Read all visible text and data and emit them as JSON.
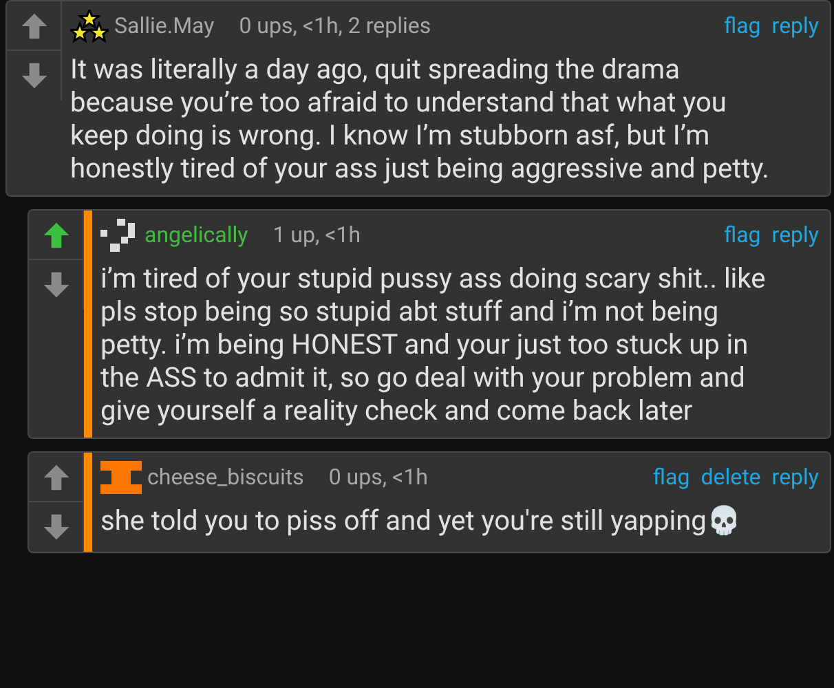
{
  "comments": [
    {
      "username": "Sallie.May",
      "color": "#a8a8a8",
      "avatar": {
        "kind": "stars"
      },
      "meta": "0 ups, <1h, 2 replies",
      "upvoted": false,
      "downvoted": false,
      "nested": false,
      "actions": [
        "flag",
        "reply"
      ],
      "text": "It was literally a day ago, quit spreading the drama because you’re too afraid to understand that what you keep doing is wrong. I know I’m stubborn asf, but I’m honestly tired of your ass just being aggressive and petty."
    },
    {
      "username": "angelically",
      "color": "#44bb44",
      "avatar": {
        "kind": "pixels"
      },
      "meta": "1 up, <1h",
      "upvoted": true,
      "downvoted": false,
      "nested": true,
      "actions": [
        "flag",
        "reply"
      ],
      "text": "i’m tired of your stupid pussy ass doing scary shit.. like pls stop being so stupid abt stuff and i’m not being petty. i’m being HONEST and your just too stuck up in the ASS to admit it, so go deal with your problem and give yourself a reality check and come back later"
    },
    {
      "username": "cheese_biscuits",
      "color": "#a8a8a8",
      "avatar": {
        "kind": "beam"
      },
      "meta": "0 ups, <1h",
      "upvoted": false,
      "downvoted": false,
      "nested": true,
      "actions": [
        "flag",
        "delete",
        "reply"
      ],
      "text": "she told you to piss off and yet you're still yapping💀"
    }
  ]
}
